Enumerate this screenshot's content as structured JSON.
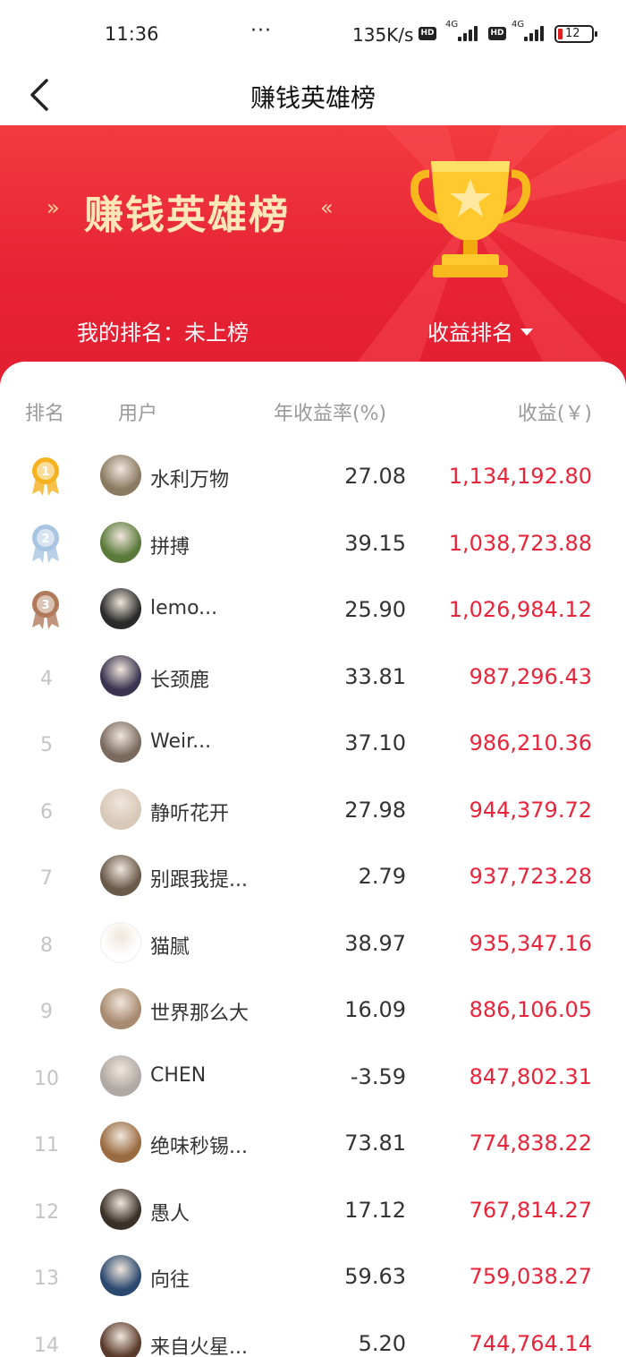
{
  "status_bar": {
    "time": "11:36",
    "dots": "···",
    "speed": "135K/s",
    "hd_label": "HD",
    "network_label": "4G",
    "battery": "12"
  },
  "nav": {
    "title": "赚钱英雄榜",
    "back_icon": "chevron-left-icon"
  },
  "banner": {
    "headline": "赚钱英雄榜",
    "chevron_left": "»",
    "chevron_right": "«",
    "my_rank": "我的排名：未上榜",
    "sort_label": "收益排名",
    "trophy_icon": "trophy-icon",
    "bg_color": "#e62234",
    "headline_color": "#ffe7b8"
  },
  "table": {
    "headers": {
      "rank": "排名",
      "user": "用户",
      "rate": "年收益率(%)",
      "earnings": "收益(￥)"
    },
    "rows": [
      {
        "rank": "1",
        "name": "水利万物",
        "rate": "27.08",
        "earnings": "1,134,192.80",
        "avatar_color": "#8a7a62"
      },
      {
        "rank": "2",
        "name": "拼搏",
        "rate": "39.15",
        "earnings": "1,038,723.88",
        "avatar_color": "#5a7a3a"
      },
      {
        "rank": "3",
        "name": "lemo...",
        "rate": "25.90",
        "earnings": "1,026,984.12",
        "avatar_color": "#2a2a2a"
      },
      {
        "rank": "4",
        "name": "长颈鹿",
        "rate": "33.81",
        "earnings": "987,296.43",
        "avatar_color": "#3a3450"
      },
      {
        "rank": "5",
        "name": "Weir...",
        "rate": "37.10",
        "earnings": "986,210.36",
        "avatar_color": "#7a6a5e"
      },
      {
        "rank": "6",
        "name": "静听花开",
        "rate": "27.98",
        "earnings": "944,379.72",
        "avatar_color": "#d8c8b8"
      },
      {
        "rank": "7",
        "name": "别跟我提...",
        "rate": "2.79",
        "earnings": "937,723.28",
        "avatar_color": "#6a5a4a"
      },
      {
        "rank": "8",
        "name": "猫腻",
        "rate": "38.97",
        "earnings": "935,347.16",
        "avatar_color": "#ffffff"
      },
      {
        "rank": "9",
        "name": "世界那么大",
        "rate": "16.09",
        "earnings": "886,106.05",
        "avatar_color": "#a88a70"
      },
      {
        "rank": "10",
        "name": "CHEN",
        "rate": "-3.59",
        "earnings": "847,802.31",
        "avatar_color": "#b0a8a4"
      },
      {
        "rank": "11",
        "name": "绝味秒锡...",
        "rate": "73.81",
        "earnings": "774,838.22",
        "avatar_color": "#9a6a40"
      },
      {
        "rank": "12",
        "name": "愚人",
        "rate": "17.12",
        "earnings": "767,814.27",
        "avatar_color": "#3a3028"
      },
      {
        "rank": "13",
        "name": "向往",
        "rate": "59.63",
        "earnings": "759,038.27",
        "avatar_color": "#2c4a70"
      },
      {
        "rank": "14",
        "name": "来自火星...",
        "rate": "5.20",
        "earnings": "744,764.14",
        "avatar_color": "#5a3a2a"
      }
    ]
  },
  "colors": {
    "earnings": "#e8243a",
    "gold": "#f4b21e",
    "silver": "#a8c4e0",
    "bronze": "#b07a5a"
  }
}
